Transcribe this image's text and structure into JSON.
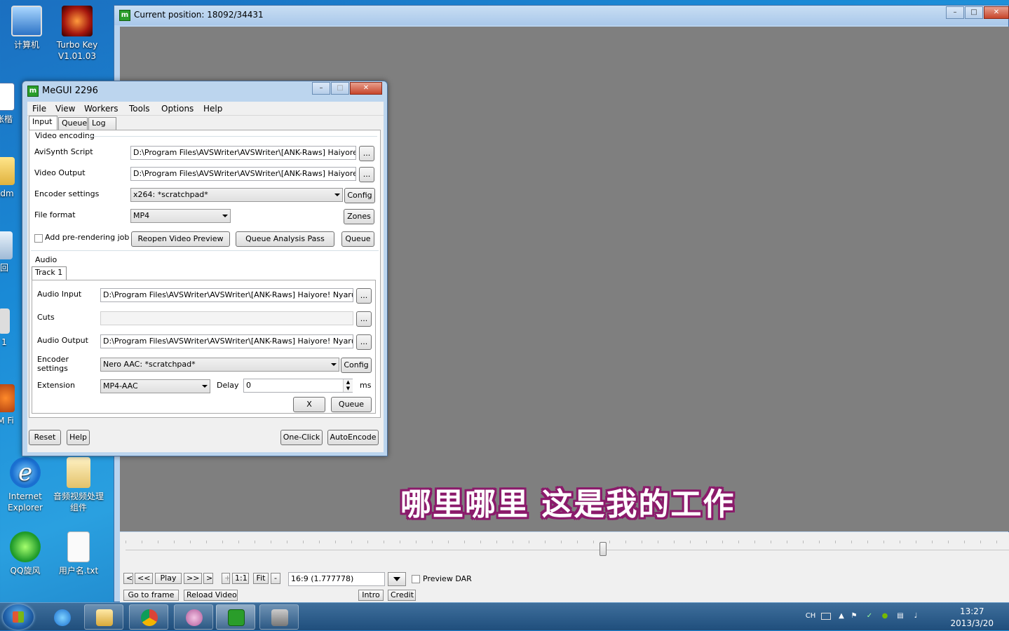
{
  "desktop": {
    "icons": [
      {
        "label": "计算机"
      },
      {
        "label": "Turbo Key V1.01.03"
      },
      {
        "label": "张楷"
      },
      {
        "label": "Adm"
      },
      {
        "label": "回"
      },
      {
        "label": "1"
      },
      {
        "label": "M Fi"
      },
      {
        "label": "Internet Explorer"
      },
      {
        "label": "音频视频处理组件"
      },
      {
        "label": "QQ旋风"
      },
      {
        "label": "用户名.txt"
      }
    ]
  },
  "preview_window": {
    "title": "Current position: 18092/34431",
    "subtitle_text": "哪里哪里  这是我的工作",
    "slider_position": 0.54,
    "buttons": {
      "prev": "<",
      "rewind": "<<",
      "play": "Play",
      "forward": ">>",
      "next": ">",
      "plus": "+",
      "one_to_one": "1:1",
      "fit": "Fit",
      "minus": "-",
      "go_to_frame": "Go to frame",
      "reload_video": "Reload Video",
      "intro": "Intro",
      "credit": "Credit"
    },
    "aspect_value": "16:9 (1.777778)",
    "preview_dar_label": "Preview DAR"
  },
  "megui": {
    "title": "MeGUI 2296",
    "menu": [
      "File",
      "View",
      "Workers",
      "Tools",
      "Options",
      "Help"
    ],
    "tabs": [
      "Input",
      "Queue",
      "Log"
    ],
    "video": {
      "section_title": "Video encoding",
      "avisynth_label": "AviSynth Script",
      "avisynth_value": "D:\\Program Files\\AVSWriter\\AVSWriter\\[ANK-Raws] Haiyore! Nyar",
      "output_label": "Video Output",
      "output_value": "D:\\Program Files\\AVSWriter\\AVSWriter\\[ANK-Raws] Haiyore! Nyar",
      "encoder_label": "Encoder settings",
      "encoder_value": "x264: *scratchpad*",
      "format_label": "File format",
      "format_value": "MP4",
      "prerender_label": "Add pre-rendering job",
      "browse": "...",
      "config": "Config",
      "zones": "Zones",
      "reopen_preview": "Reopen Video Preview",
      "queue_analysis": "Queue Analysis Pass",
      "queue": "Queue"
    },
    "audio": {
      "section_title": "Audio",
      "track_tab": "Track 1",
      "input_label": "Audio Input",
      "input_value": "D:\\Program Files\\AVSWriter\\AVSWriter\\[ANK-Raws] Haiyore! Nyaruko-san",
      "cuts_label": "Cuts",
      "cuts_value": "",
      "output_label": "Audio Output",
      "output_value": "D:\\Program Files\\AVSWriter\\AVSWriter\\[ANK-Raws] Haiyore! Nyaruko-san",
      "encoder_label_1": "Encoder",
      "encoder_label_2": "settings",
      "encoder_value": "Nero AAC: *scratchpad*",
      "extension_label": "Extension",
      "extension_value": "MP4-AAC",
      "delay_label": "Delay",
      "delay_value": "0",
      "ms_label": "ms",
      "browse": "...",
      "config": "Config",
      "x_button": "X",
      "queue": "Queue"
    },
    "bottom": {
      "reset": "Reset",
      "help": "Help",
      "one_click": "One-Click",
      "autoencode": "AutoEncode"
    }
  },
  "taskbar": {
    "lang": "CH",
    "time": "13:27",
    "date": "2013/3/20"
  }
}
